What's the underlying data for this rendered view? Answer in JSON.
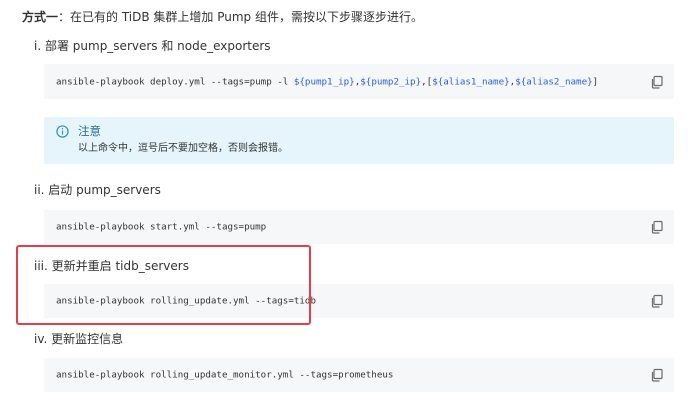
{
  "intro": {
    "bold": "方式一",
    "text": "：在已有的 TiDB 集群上增加 Pump 组件，需按以下步骤逐步进行。"
  },
  "steps": [
    {
      "title": "i. 部署 pump_servers 和 node_exporters",
      "code": {
        "prefix": "ansible-playbook deploy.yml --tags=pump -l ",
        "v1": "${pump1_ip}",
        "s1": ",",
        "v2": "${pump2_ip}",
        "s2": ",[",
        "v3": "${alias1_name}",
        "s3": ",",
        "v4": "${alias2_name}",
        "s4": "]"
      }
    },
    {
      "title": "ii. 启动 pump_servers",
      "code": "ansible-playbook start.yml --tags=pump"
    },
    {
      "title": "iii. 更新并重启 tidb_servers",
      "code": "ansible-playbook rolling_update.yml --tags=tidb"
    },
    {
      "title": "iv. 更新监控信息",
      "code": "ansible-playbook rolling_update_monitor.yml --tags=prometheus"
    }
  ],
  "note": {
    "title": "注意",
    "body": "以上命令中，逗号后不要加空格，否则会报错。"
  },
  "icons": {
    "copy": "copy-icon",
    "info": "info-icon"
  },
  "colors": {
    "code_bg": "#f6f7f8",
    "note_bg": "#e6f5fb",
    "variable": "#2b62d6",
    "highlight": "#e43d4b"
  }
}
